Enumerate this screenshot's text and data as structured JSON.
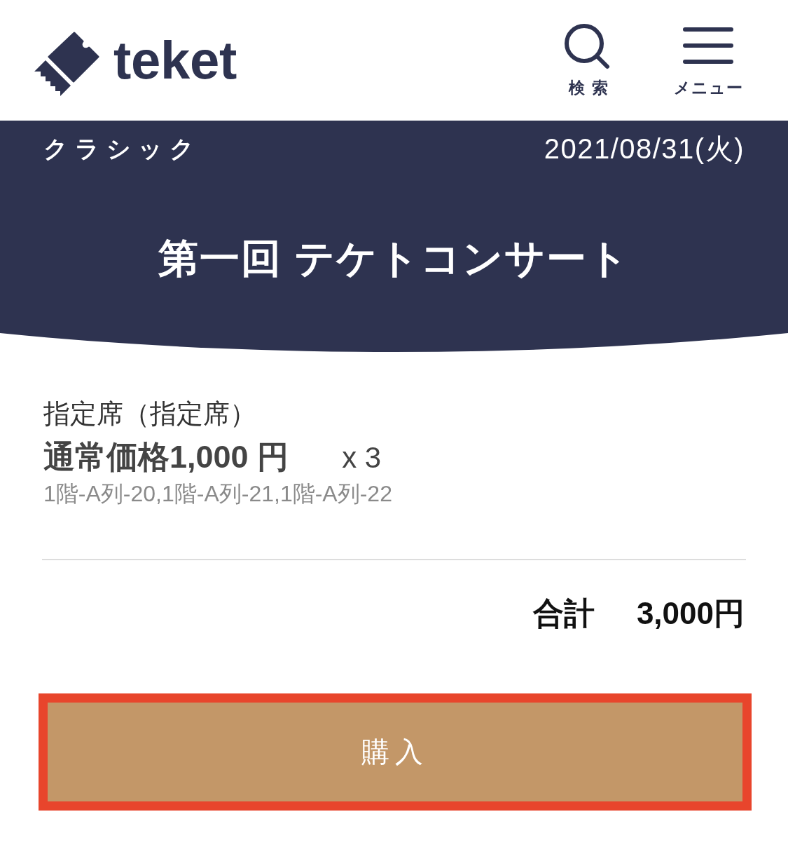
{
  "header": {
    "logo": {
      "text": "teket"
    },
    "actions": [
      {
        "kind": "search",
        "label": "検索"
      },
      {
        "kind": "menu",
        "label": "メニュー"
      }
    ]
  },
  "event": {
    "category": "クラシック",
    "date": "2021/08/31(火)",
    "title": "第一回 テケトコンサート"
  },
  "order": {
    "seat_type": "指定席（指定席）",
    "price": "通常価格1,000 円",
    "quantity": "x 3",
    "seats": "1階-A列-20,1階-A列-21,1階-A列-22"
  },
  "total": {
    "label": "合計",
    "amount": "3,000円"
  },
  "purchase_button": {
    "label": "購入",
    "highlighted": true
  }
}
